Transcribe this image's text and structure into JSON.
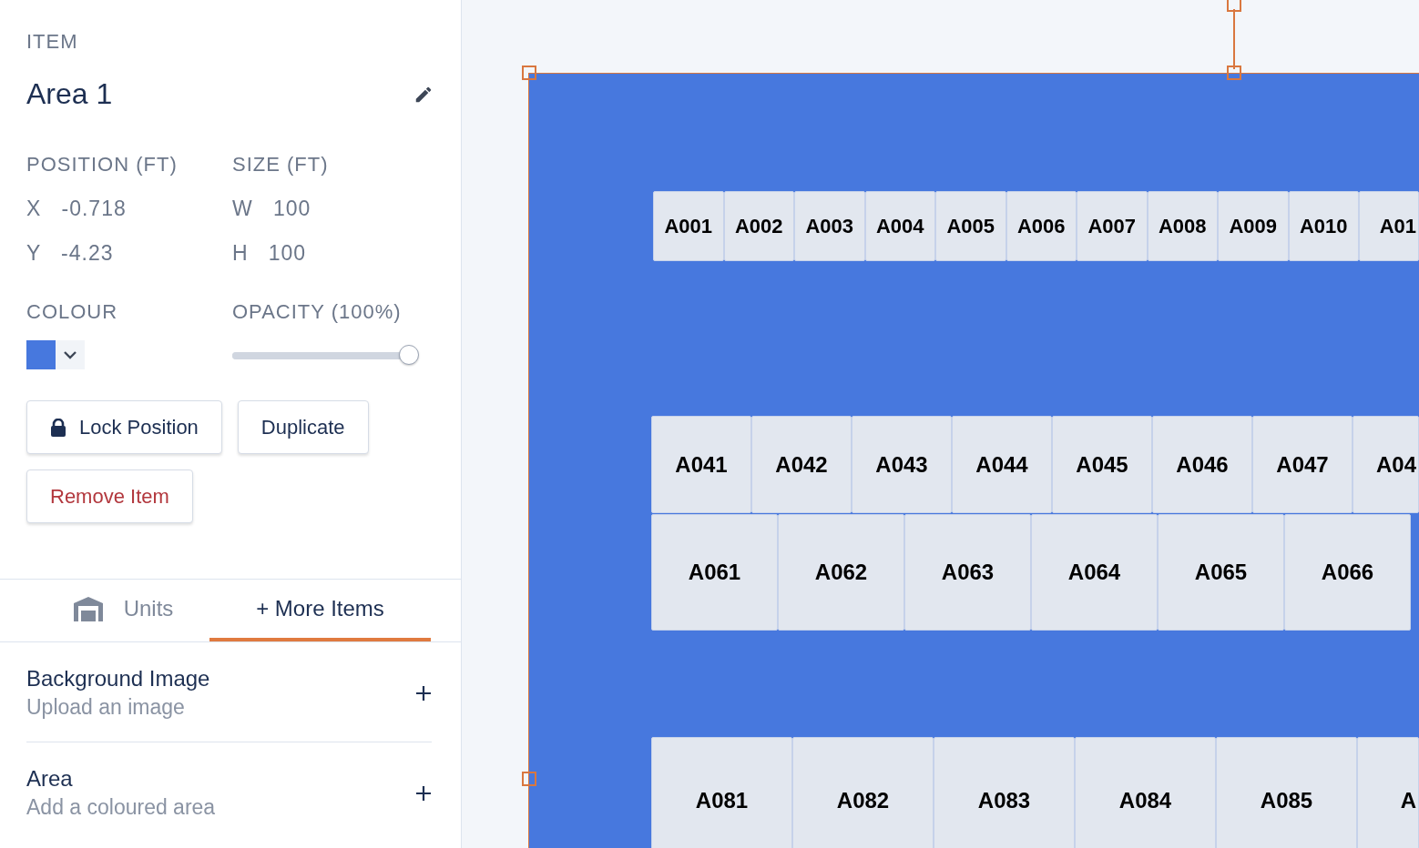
{
  "panel": {
    "section_label": "ITEM",
    "item_name": "Area 1",
    "position": {
      "label": "POSITION (FT)",
      "fields": [
        {
          "axis": "X",
          "value": "-0.718"
        },
        {
          "axis": "Y",
          "value": "-4.23"
        }
      ]
    },
    "size": {
      "label": "SIZE (FT)",
      "fields": [
        {
          "axis": "W",
          "value": "100"
        },
        {
          "axis": "H",
          "value": "100"
        }
      ]
    },
    "colour": {
      "label": "COLOUR",
      "color": "#4778de"
    },
    "opacity": {
      "label": "OPACITY (100%)",
      "level": 1
    },
    "buttons": [
      {
        "label": "Lock Position",
        "kind": "lock"
      },
      {
        "label": "Duplicate",
        "kind": "plain"
      },
      {
        "label": "Remove Item",
        "kind": "danger"
      }
    ]
  },
  "tabs": [
    {
      "label": "Units",
      "selected": false,
      "kind": "units"
    },
    {
      "label": "+ More Items",
      "selected": true,
      "kind": "plain"
    }
  ],
  "add_items": [
    {
      "title": "Background Image",
      "subtitle": "Upload an image"
    },
    {
      "title": "Area",
      "subtitle": "Add a coloured area"
    }
  ],
  "canvas": {
    "rows": [
      {
        "kind": "small",
        "units": [
          "A001",
          "A002",
          "A003",
          "A004",
          "A005",
          "A006",
          "A007",
          "A008",
          "A009",
          "A010"
        ],
        "cut_unit": "A01"
      },
      {
        "kind": "medium",
        "units": [
          "A041",
          "A042",
          "A043",
          "A044",
          "A045",
          "A046",
          "A047"
        ],
        "cut_unit": "A04"
      },
      {
        "kind": "large",
        "units": [
          "A061",
          "A062",
          "A063",
          "A064",
          "A065",
          "A066"
        ]
      },
      {
        "kind": "xlarge",
        "units": [
          "A081",
          "A082",
          "A083",
          "A084",
          "A085"
        ],
        "cut_unit": "A"
      }
    ]
  }
}
